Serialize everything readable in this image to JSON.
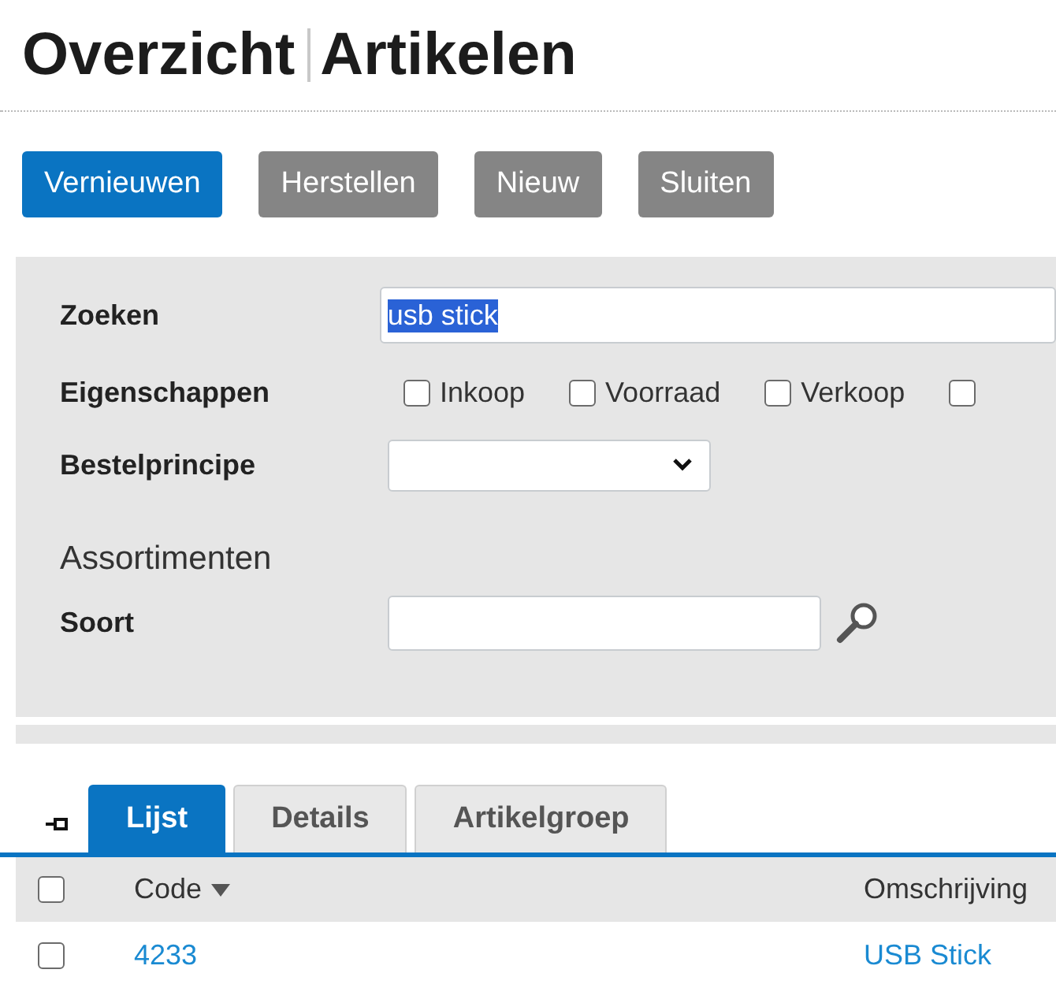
{
  "header": {
    "title": "Overzicht",
    "subtitle": "Artikelen"
  },
  "buttons": [
    {
      "label": "Vernieuwen",
      "primary": true
    },
    {
      "label": "Herstellen",
      "primary": false
    },
    {
      "label": "Nieuw",
      "primary": false
    },
    {
      "label": "Sluiten",
      "primary": false
    }
  ],
  "filters": {
    "search": {
      "label": "Zoeken",
      "value": "usb stick",
      "text_selected": true
    },
    "properties": {
      "label": "Eigenschappen",
      "options": [
        {
          "label": "Inkoop",
          "checked": false
        },
        {
          "label": "Voorraad",
          "checked": false
        },
        {
          "label": "Verkoop",
          "checked": false
        },
        {
          "checked": false
        }
      ]
    },
    "order_principle": {
      "label": "Bestelprincipe"
    },
    "section_title": "Assortimenten",
    "kind_field": {
      "label": "Soort"
    }
  },
  "tabs": [
    {
      "label": "Lijst",
      "selected": true
    },
    {
      "label": "Details",
      "selected": false
    },
    {
      "label": "Artikelgroep",
      "selected": false
    }
  ],
  "table": {
    "all_checked": false,
    "columns": [
      {
        "label": "Code",
        "sorted_descending": true
      },
      {
        "label": "Omschrijving",
        "sorted_descending": false
      }
    ],
    "rows": [
      {
        "checked": false,
        "cells": [
          "4233",
          "USB Stick"
        ]
      }
    ]
  }
}
